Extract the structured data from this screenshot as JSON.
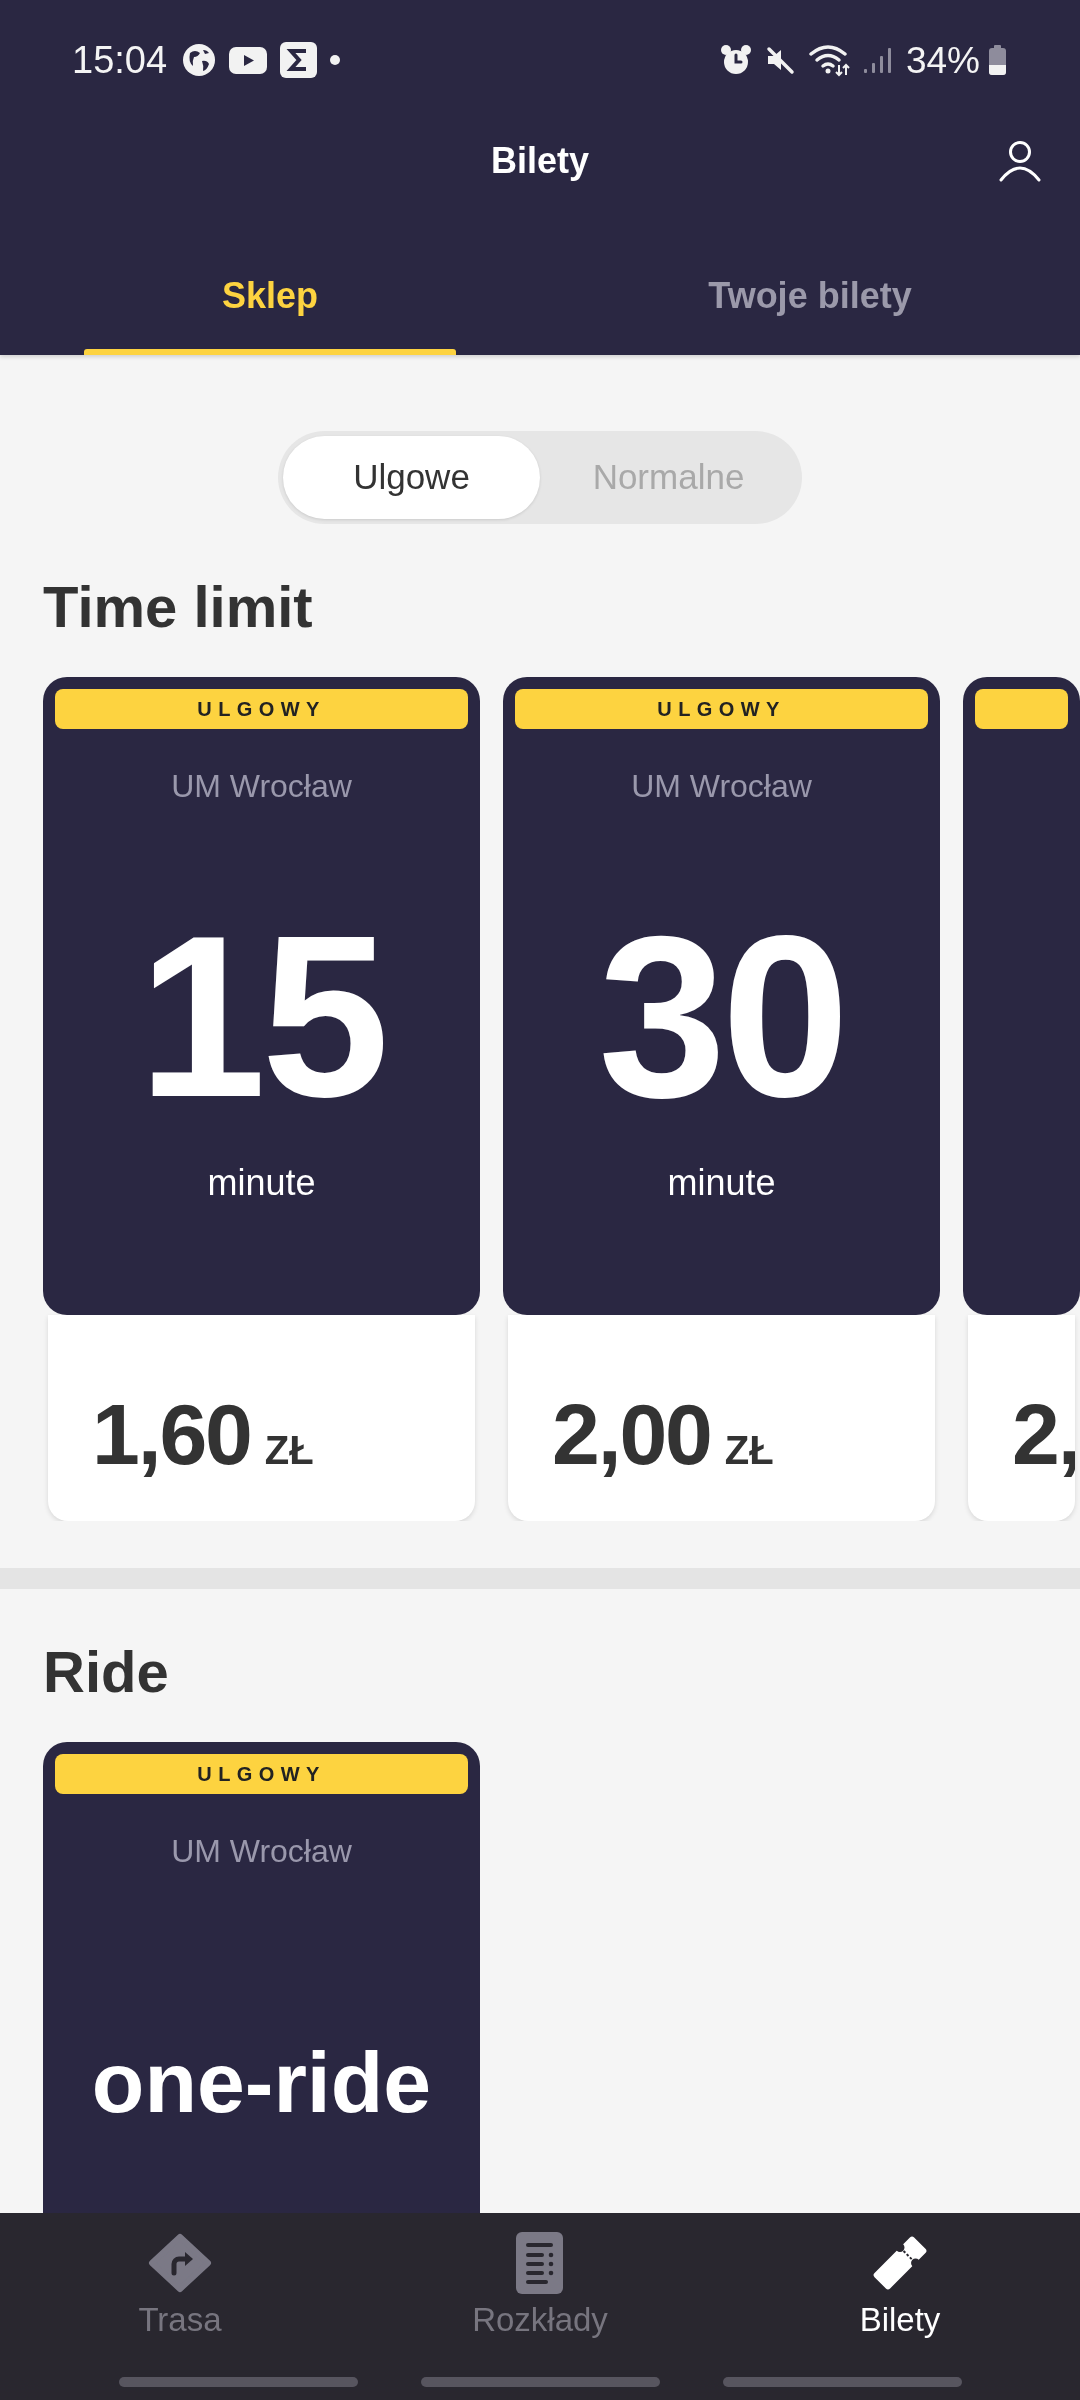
{
  "status_bar": {
    "time": "15:04",
    "battery": "34%"
  },
  "app_bar": {
    "title": "Bilety"
  },
  "tabs": [
    {
      "label": "Sklep",
      "selected": true
    },
    {
      "label": "Twoje bilety",
      "selected": false
    }
  ],
  "fare_type_toggle": [
    {
      "label": "Ulgowe",
      "selected": true
    },
    {
      "label": "Normalne",
      "selected": false
    }
  ],
  "sections": [
    {
      "title": "Time limit",
      "tickets": [
        {
          "kind": "duration",
          "badge": "ULGOWY",
          "operator": "UM Wrocław",
          "value": "15",
          "unit": "minute",
          "price": "1,60",
          "currency": "ZŁ"
        },
        {
          "kind": "duration",
          "badge": "ULGOWY",
          "operator": "UM Wrocław",
          "value": "30",
          "unit": "minute",
          "price": "2,00",
          "currency": "ZŁ"
        },
        {
          "kind": "duration",
          "price": "2,"
        }
      ]
    },
    {
      "title": "Ride",
      "tickets": [
        {
          "kind": "ride",
          "badge": "ULGOWY",
          "operator": "UM Wrocław",
          "value": "one-ride"
        }
      ]
    }
  ],
  "bottom_nav": [
    {
      "label": "Trasa",
      "selected": false
    },
    {
      "label": "Rozkłady",
      "selected": false
    },
    {
      "label": "Bilety",
      "selected": true
    }
  ]
}
